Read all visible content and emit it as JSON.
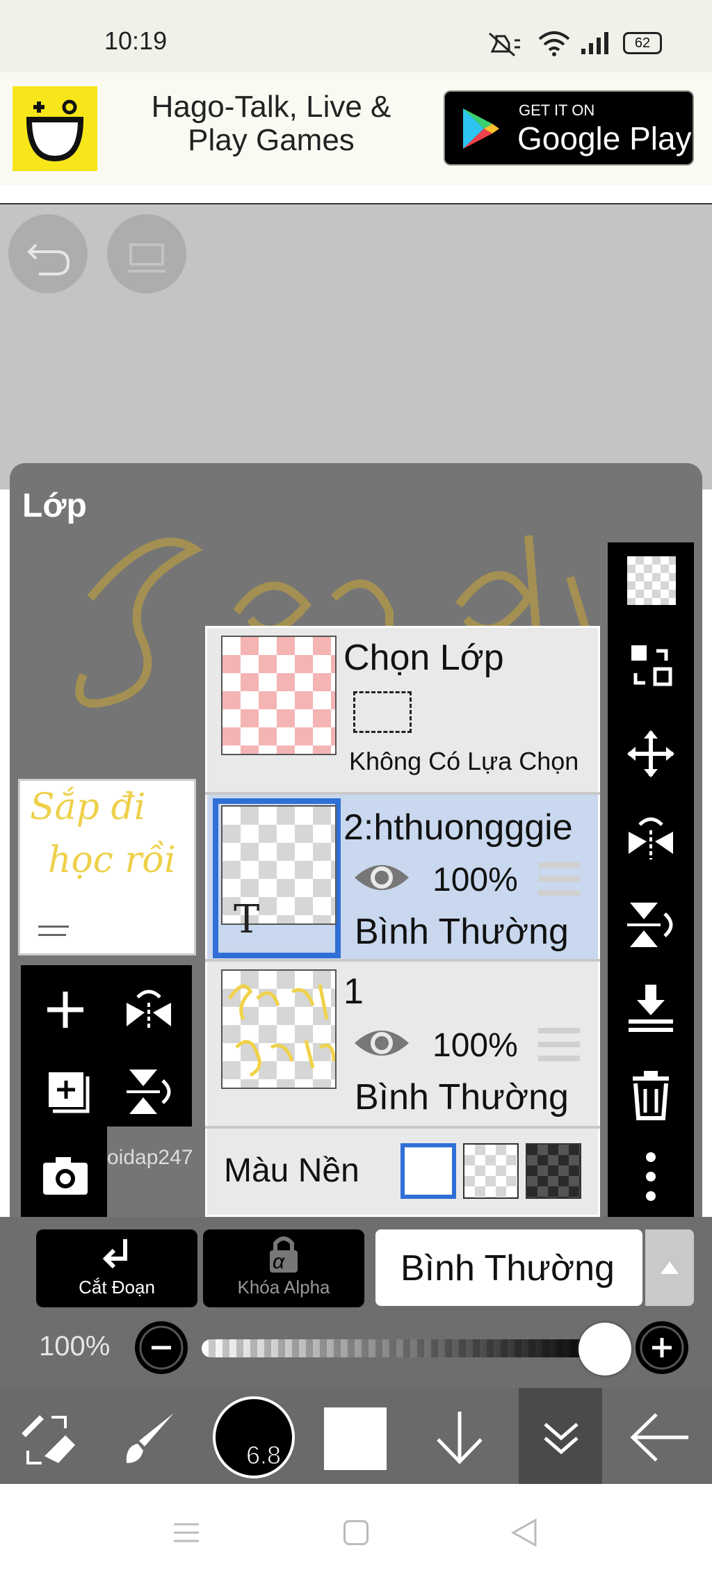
{
  "status_bar": {
    "time": "10:19",
    "battery": "62"
  },
  "ad": {
    "title_line1": "Hago-Talk, Live &",
    "title_line2": "Play Games",
    "store_small": "GET IT ON",
    "store_big": "Google Play"
  },
  "panel": {
    "title": "Lớp"
  },
  "selection_layer": {
    "title": "Chọn Lớp",
    "status": "Không Có Lựa Chọn"
  },
  "layers": [
    {
      "name": "2:hthuongggie",
      "opacity": "100%",
      "blend": "Bình Thường",
      "selected": true,
      "thumb_letter": "T"
    },
    {
      "name": "1",
      "opacity": "100%",
      "blend": "Bình Thường",
      "selected": false
    }
  ],
  "background": {
    "label": "Màu Nền"
  },
  "preview": {
    "line1": "Sắp đi",
    "line2": "học rồi"
  },
  "watermark": "oidap247",
  "controls": {
    "clip_label": "Cắt Đoạn",
    "alpha_lock_label": "Khóa Alpha",
    "alpha_symbol": "α",
    "blend_mode": "Bình Thường",
    "opacity_label": "100%",
    "opacity_value": 1.0
  },
  "bottom_toolbar": {
    "brush_size": "6.8"
  },
  "colors": {
    "accent": "#2f6fd6",
    "selected_row": "#c9d8ee",
    "gold": "#e8c84a"
  }
}
